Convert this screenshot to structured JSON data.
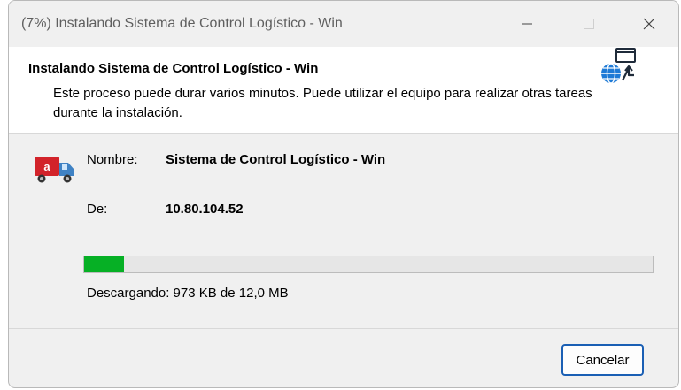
{
  "window": {
    "title": "(7%) Instalando Sistema de Control Logístico - Win"
  },
  "header": {
    "title": "Instalando Sistema de Control Logístico - Win",
    "description": "Este proceso puede durar varios minutos. Puede utilizar el equipo para realizar otras tareas durante la instalación.",
    "icon": "globe-network-icon"
  },
  "details": {
    "app_icon": "truck-icon",
    "name_label": "Nombre:",
    "name_value": "Sistema de Control Logístico - Win",
    "from_label": "De:",
    "from_value": "10.80.104.52"
  },
  "progress": {
    "percent": 7,
    "fill_color": "#06b025",
    "status_text": "Descargando: 973 KB de 12,0 MB"
  },
  "buttons": {
    "cancel_label": "Cancelar"
  },
  "colors": {
    "accent": "#1a5fb4"
  }
}
